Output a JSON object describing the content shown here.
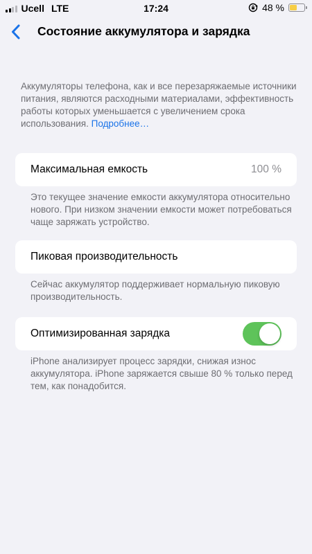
{
  "status_bar": {
    "carrier": "Ucell",
    "network": "LTE",
    "time": "17:24",
    "battery_percent": "48 %",
    "battery_level": 0.48,
    "battery_color": "#f7ce46",
    "icons": [
      "signal-bars-icon",
      "orientation-lock-icon",
      "battery-icon"
    ]
  },
  "nav": {
    "title": "Состояние аккумулятора и зарядка",
    "back_icon": "chevron-left-icon",
    "accent_color": "#1a73e8"
  },
  "intro": {
    "text": "Аккумуляторы телефона, как и все перезаряжаемые источники питания, являются расходными материалами, эффективность работы которых уменьшается с увеличением срока использования. ",
    "link": "Подробнее…"
  },
  "max_capacity": {
    "label": "Максимальная емкость",
    "value": "100 %",
    "footnote": "Это текущее значение емкости аккумулятора относительно нового. При низком значении емкости может потребоваться чаще заряжать устройство."
  },
  "peak_performance": {
    "label": "Пиковая производительность",
    "footnote": "Сейчас аккумулятор поддерживает нормальную пиковую производительность."
  },
  "optimized_charging": {
    "label": "Оптимизированная зарядка",
    "enabled": true,
    "toggle_color": "#5ec35a",
    "footnote": "iPhone анализирует процесс зарядки, снижая износ аккумулятора. iPhone заряжается свыше 80 % только перед тем, как понадобится."
  }
}
